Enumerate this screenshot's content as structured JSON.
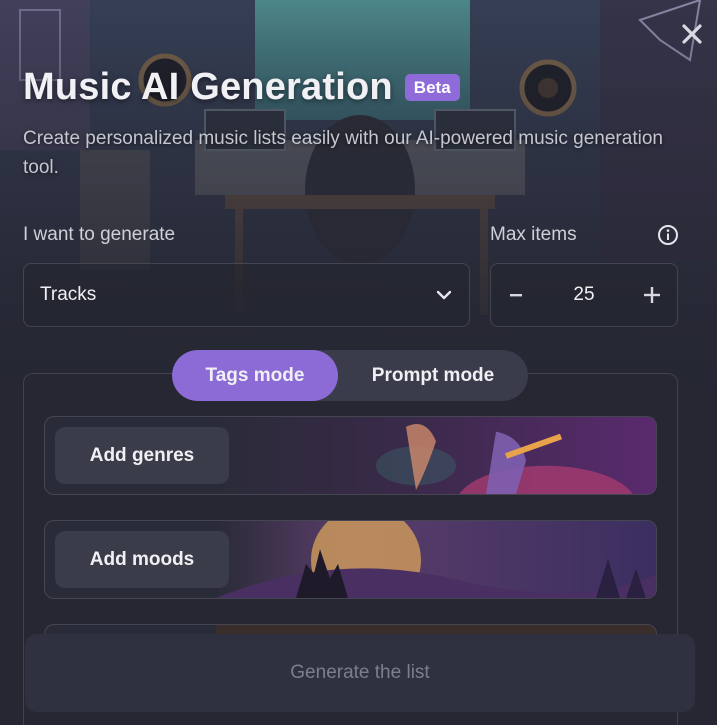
{
  "dialog": {
    "title": "Music AI Generation",
    "badge": "Beta",
    "subtitle": "Create personalized music lists easily with our AI-powered music generation tool."
  },
  "form": {
    "generate_label": "I want to generate",
    "generate_value": "Tracks",
    "max_items_label": "Max items",
    "max_items_value": "25",
    "decrement_symbol": "–",
    "increment_symbol": "+"
  },
  "modes": {
    "tags_label": "Tags mode",
    "prompt_label": "Prompt mode",
    "active": "Tags mode"
  },
  "tags": {
    "genres_label": "Add genres",
    "moods_label": "Add moods"
  },
  "actions": {
    "generate_label": "Generate the list"
  },
  "colors": {
    "accent": "#8c6bd6",
    "background": "#262733",
    "card": "#3a3c4a"
  },
  "icons": {
    "close": "close-icon",
    "info": "info-icon",
    "chevron": "chevron-down-icon",
    "minus": "minus-icon",
    "plus": "plus-icon"
  }
}
